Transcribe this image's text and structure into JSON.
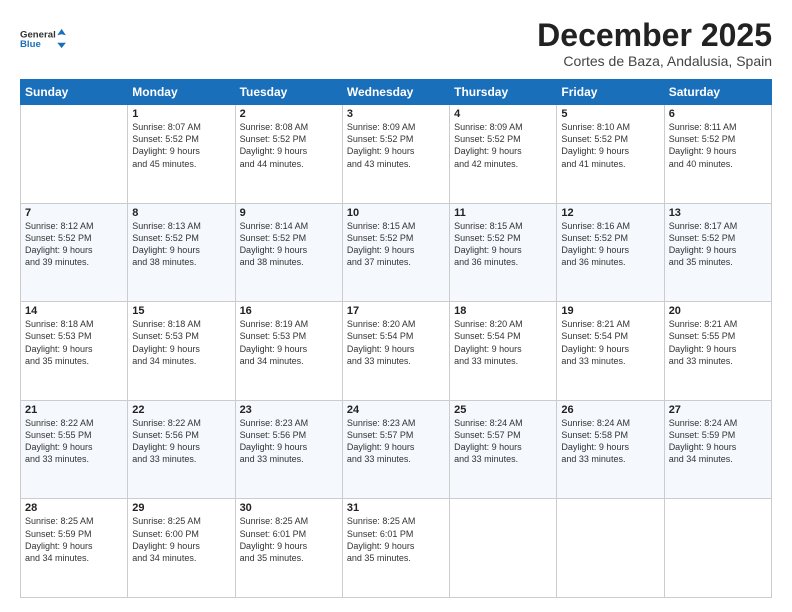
{
  "header": {
    "logo_general": "General",
    "logo_blue": "Blue",
    "month_title": "December 2025",
    "location": "Cortes de Baza, Andalusia, Spain"
  },
  "days_of_week": [
    "Sunday",
    "Monday",
    "Tuesday",
    "Wednesday",
    "Thursday",
    "Friday",
    "Saturday"
  ],
  "weeks": [
    [
      {
        "day": "",
        "info": ""
      },
      {
        "day": "1",
        "info": "Sunrise: 8:07 AM\nSunset: 5:52 PM\nDaylight: 9 hours\nand 45 minutes."
      },
      {
        "day": "2",
        "info": "Sunrise: 8:08 AM\nSunset: 5:52 PM\nDaylight: 9 hours\nand 44 minutes."
      },
      {
        "day": "3",
        "info": "Sunrise: 8:09 AM\nSunset: 5:52 PM\nDaylight: 9 hours\nand 43 minutes."
      },
      {
        "day": "4",
        "info": "Sunrise: 8:09 AM\nSunset: 5:52 PM\nDaylight: 9 hours\nand 42 minutes."
      },
      {
        "day": "5",
        "info": "Sunrise: 8:10 AM\nSunset: 5:52 PM\nDaylight: 9 hours\nand 41 minutes."
      },
      {
        "day": "6",
        "info": "Sunrise: 8:11 AM\nSunset: 5:52 PM\nDaylight: 9 hours\nand 40 minutes."
      }
    ],
    [
      {
        "day": "7",
        "info": "Sunrise: 8:12 AM\nSunset: 5:52 PM\nDaylight: 9 hours\nand 39 minutes."
      },
      {
        "day": "8",
        "info": "Sunrise: 8:13 AM\nSunset: 5:52 PM\nDaylight: 9 hours\nand 38 minutes."
      },
      {
        "day": "9",
        "info": "Sunrise: 8:14 AM\nSunset: 5:52 PM\nDaylight: 9 hours\nand 38 minutes."
      },
      {
        "day": "10",
        "info": "Sunrise: 8:15 AM\nSunset: 5:52 PM\nDaylight: 9 hours\nand 37 minutes."
      },
      {
        "day": "11",
        "info": "Sunrise: 8:15 AM\nSunset: 5:52 PM\nDaylight: 9 hours\nand 36 minutes."
      },
      {
        "day": "12",
        "info": "Sunrise: 8:16 AM\nSunset: 5:52 PM\nDaylight: 9 hours\nand 36 minutes."
      },
      {
        "day": "13",
        "info": "Sunrise: 8:17 AM\nSunset: 5:52 PM\nDaylight: 9 hours\nand 35 minutes."
      }
    ],
    [
      {
        "day": "14",
        "info": "Sunrise: 8:18 AM\nSunset: 5:53 PM\nDaylight: 9 hours\nand 35 minutes."
      },
      {
        "day": "15",
        "info": "Sunrise: 8:18 AM\nSunset: 5:53 PM\nDaylight: 9 hours\nand 34 minutes."
      },
      {
        "day": "16",
        "info": "Sunrise: 8:19 AM\nSunset: 5:53 PM\nDaylight: 9 hours\nand 34 minutes."
      },
      {
        "day": "17",
        "info": "Sunrise: 8:20 AM\nSunset: 5:54 PM\nDaylight: 9 hours\nand 33 minutes."
      },
      {
        "day": "18",
        "info": "Sunrise: 8:20 AM\nSunset: 5:54 PM\nDaylight: 9 hours\nand 33 minutes."
      },
      {
        "day": "19",
        "info": "Sunrise: 8:21 AM\nSunset: 5:54 PM\nDaylight: 9 hours\nand 33 minutes."
      },
      {
        "day": "20",
        "info": "Sunrise: 8:21 AM\nSunset: 5:55 PM\nDaylight: 9 hours\nand 33 minutes."
      }
    ],
    [
      {
        "day": "21",
        "info": "Sunrise: 8:22 AM\nSunset: 5:55 PM\nDaylight: 9 hours\nand 33 minutes."
      },
      {
        "day": "22",
        "info": "Sunrise: 8:22 AM\nSunset: 5:56 PM\nDaylight: 9 hours\nand 33 minutes."
      },
      {
        "day": "23",
        "info": "Sunrise: 8:23 AM\nSunset: 5:56 PM\nDaylight: 9 hours\nand 33 minutes."
      },
      {
        "day": "24",
        "info": "Sunrise: 8:23 AM\nSunset: 5:57 PM\nDaylight: 9 hours\nand 33 minutes."
      },
      {
        "day": "25",
        "info": "Sunrise: 8:24 AM\nSunset: 5:57 PM\nDaylight: 9 hours\nand 33 minutes."
      },
      {
        "day": "26",
        "info": "Sunrise: 8:24 AM\nSunset: 5:58 PM\nDaylight: 9 hours\nand 33 minutes."
      },
      {
        "day": "27",
        "info": "Sunrise: 8:24 AM\nSunset: 5:59 PM\nDaylight: 9 hours\nand 34 minutes."
      }
    ],
    [
      {
        "day": "28",
        "info": "Sunrise: 8:25 AM\nSunset: 5:59 PM\nDaylight: 9 hours\nand 34 minutes."
      },
      {
        "day": "29",
        "info": "Sunrise: 8:25 AM\nSunset: 6:00 PM\nDaylight: 9 hours\nand 34 minutes."
      },
      {
        "day": "30",
        "info": "Sunrise: 8:25 AM\nSunset: 6:01 PM\nDaylight: 9 hours\nand 35 minutes."
      },
      {
        "day": "31",
        "info": "Sunrise: 8:25 AM\nSunset: 6:01 PM\nDaylight: 9 hours\nand 35 minutes."
      },
      {
        "day": "",
        "info": ""
      },
      {
        "day": "",
        "info": ""
      },
      {
        "day": "",
        "info": ""
      }
    ]
  ]
}
